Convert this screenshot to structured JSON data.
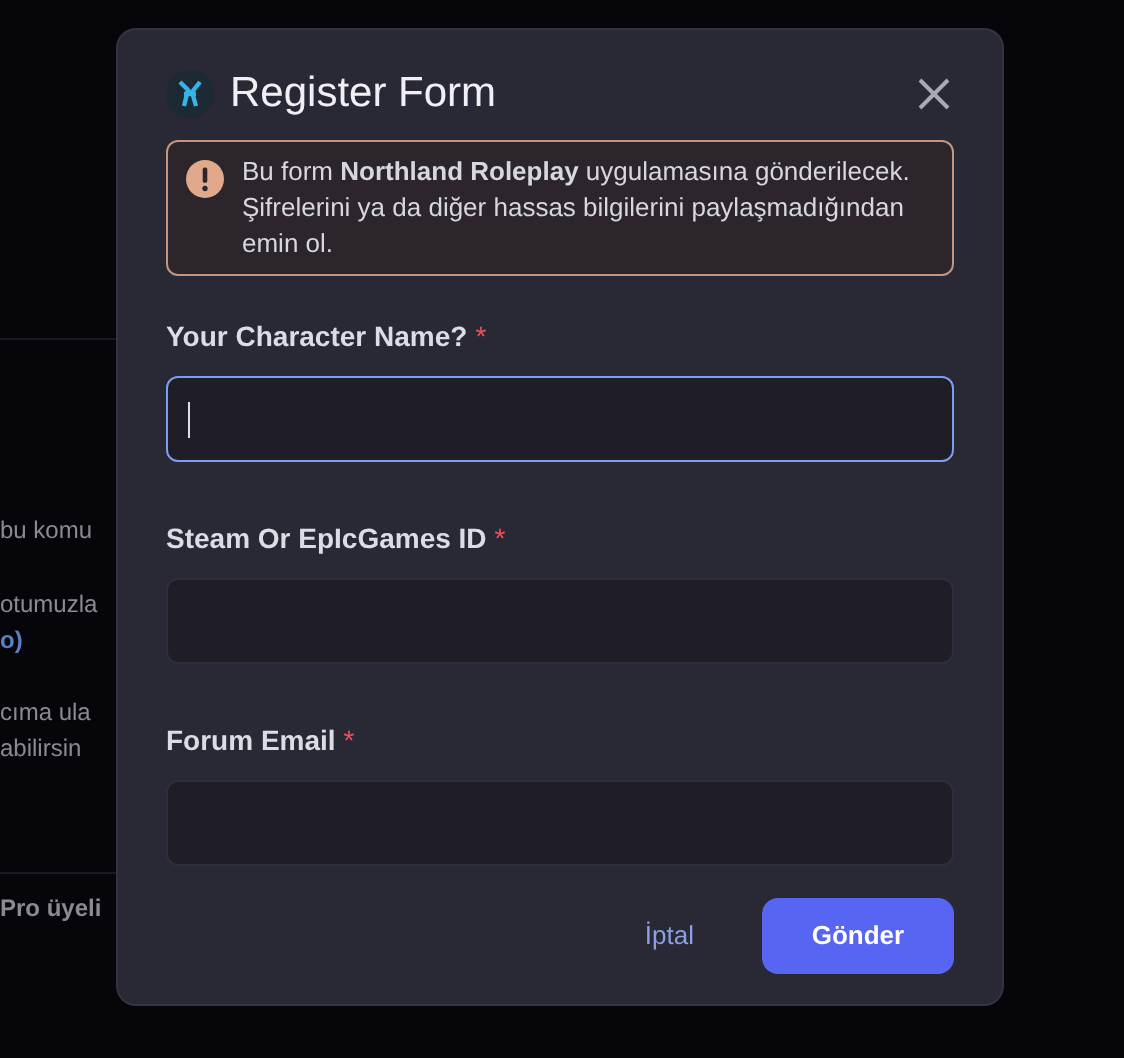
{
  "background": {
    "fragments": [
      {
        "kind": "text",
        "text": "bu komu"
      },
      {
        "kind": "text",
        "text": "otumuzla"
      },
      {
        "kind": "link",
        "text": "o)"
      },
      {
        "kind": "text",
        "text": "cıma ula"
      },
      {
        "kind": "text",
        "text": "abilirsin"
      },
      {
        "kind": "bar",
        "text": "Pro üyeli"
      }
    ]
  },
  "dialog": {
    "title": "Register Form",
    "notice": "Bu form **Northland Roleplay** uygulamasına gönderilecek. Şifrelerini ya da diğer hassas bilgilerini paylaşmadığından emin ol.",
    "fields": [
      {
        "label": "Your Character Name?",
        "required_mark": "*",
        "focused": true
      },
      {
        "label": "Steam Or EpIcGames ID",
        "required_mark": "*",
        "focused": false
      },
      {
        "label": "Forum Email",
        "required_mark": "*",
        "focused": false
      }
    ],
    "cancel": "İptal",
    "submit": "Gönder"
  }
}
